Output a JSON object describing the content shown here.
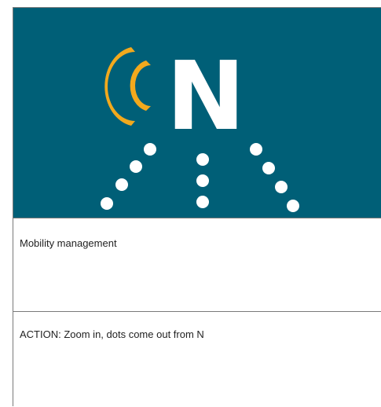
{
  "storyboard": {
    "frame": {
      "logo_letter": "N",
      "colors": {
        "background": "#005f77",
        "waves": "#f2a91d",
        "letter": "#ffffff",
        "dots": "#ffffff"
      }
    },
    "caption": "Mobility management",
    "action": "ACTION: Zoom in, dots come out from N"
  }
}
